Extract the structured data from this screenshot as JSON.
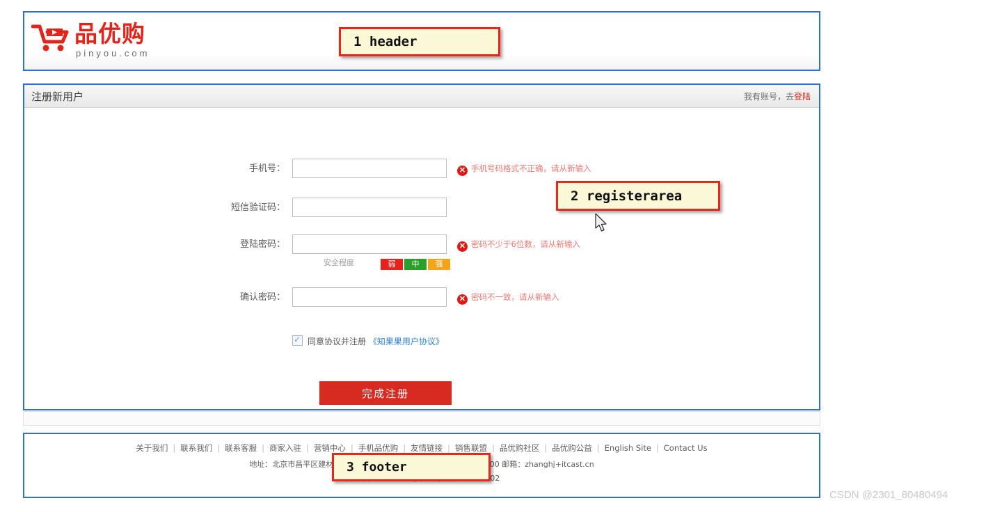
{
  "header": {
    "logo_text": "品优购",
    "logo_sub": "pinyou.com",
    "logo_icon": "shopping-cart-icon"
  },
  "register": {
    "title": "注册新用户",
    "have_account_prefix": "我有账号，去",
    "have_account_link": "登陆",
    "fields": [
      {
        "label": "手机号：",
        "value": "",
        "placeholder": "",
        "error": "手机号码格式不正确，请从新输入",
        "has_error": true
      },
      {
        "label": "短信验证码：",
        "value": "",
        "placeholder": "",
        "error": "",
        "has_error": false
      },
      {
        "label": "登陆密码：",
        "value": "",
        "placeholder": "",
        "error": "密码不少于6位数，请从新输入",
        "has_error": true
      },
      {
        "label": "确认密码：",
        "value": "",
        "placeholder": "",
        "error": "密码不一致，请从新输入",
        "has_error": true
      }
    ],
    "strength": {
      "label": "安全程度",
      "levels": [
        "弱",
        "中",
        "强"
      ],
      "colors": [
        "#e8211a",
        "#2aa02a",
        "#f5a418"
      ]
    },
    "agree": {
      "checked": true,
      "text": "同意协议并注册",
      "link": "《知果果用户协议》"
    },
    "submit_label": "完成注册"
  },
  "footer": {
    "links": [
      "关于我们",
      "联系我们",
      "联系客服",
      "商家入驻",
      "营销中心",
      "手机品优购",
      "友情链接",
      "销售联盟",
      "品优购社区",
      "品优购公益",
      "English Site",
      "Contact Us"
    ],
    "separator": "|",
    "address": "地址：北京市昌平区建材城西路金燕龙办公楼一层 电话：010-82935100 邮箱：zhanghj+itcast.cn",
    "icp": "京ICP备08001421号京公网安备110108702"
  },
  "callouts": [
    {
      "id": "header",
      "text": "1 header"
    },
    {
      "id": "register",
      "text": "2 registerarea"
    },
    {
      "id": "footer",
      "text": "3 footer"
    }
  ],
  "watermark": "CSDN @2301_80480494",
  "colors": {
    "brand_red": "#e1251b",
    "annotation_border": "#2d6fd4",
    "callout_bg": "#fbf8d8",
    "callout_border": "#e8261a"
  }
}
